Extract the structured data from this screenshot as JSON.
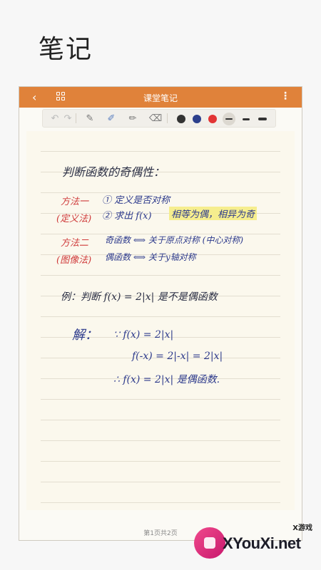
{
  "page_heading": "笔记",
  "app": {
    "title": "课堂笔记",
    "back_glyph": "‹",
    "more_glyph": "⋮"
  },
  "toolbar": {
    "undo_glyph": "↶",
    "redo_glyph": "↷",
    "pen_glyph": "✎",
    "marker_glyph": "✐",
    "highlighter_glyph": "✏",
    "eraser_glyph": "⌫",
    "colors": [
      "#333333",
      "#2b3f8c",
      "#e23434"
    ],
    "icons": [
      "undo-icon",
      "redo-icon",
      "pen-icon",
      "marker-icon",
      "highlighter-icon",
      "eraser-icon"
    ]
  },
  "note": {
    "title_line": "判断函数的奇偶性：",
    "method1_label": "方法一",
    "method1_tag": "(定义法)",
    "method1_line1": "① 定义是否对称",
    "method1_line2": "② 求出 f(x)",
    "method1_highlight": "相等为偶，相异为奇",
    "method2_label": "方法二",
    "method2_tag": "(图像法)",
    "method2_line1": "奇函数 ⟺ 关于原点对称 (中心对称)",
    "method2_line2": "偶函数 ⟺ 关于y轴对称",
    "example_line": "例：判断 f(x) = 2|x| 是不是偶函数",
    "solution_label": "解：",
    "solution_line1": "∵ f(x) = 2|x|",
    "solution_line2": "f(-x) = 2|-x| = 2|x|",
    "solution_line3": "∴ f(x) = 2|x| 是偶函数."
  },
  "footer": {
    "pager": "第1页共2页"
  },
  "watermark": {
    "small": "X游戏",
    "big": "XYouXi.net"
  }
}
